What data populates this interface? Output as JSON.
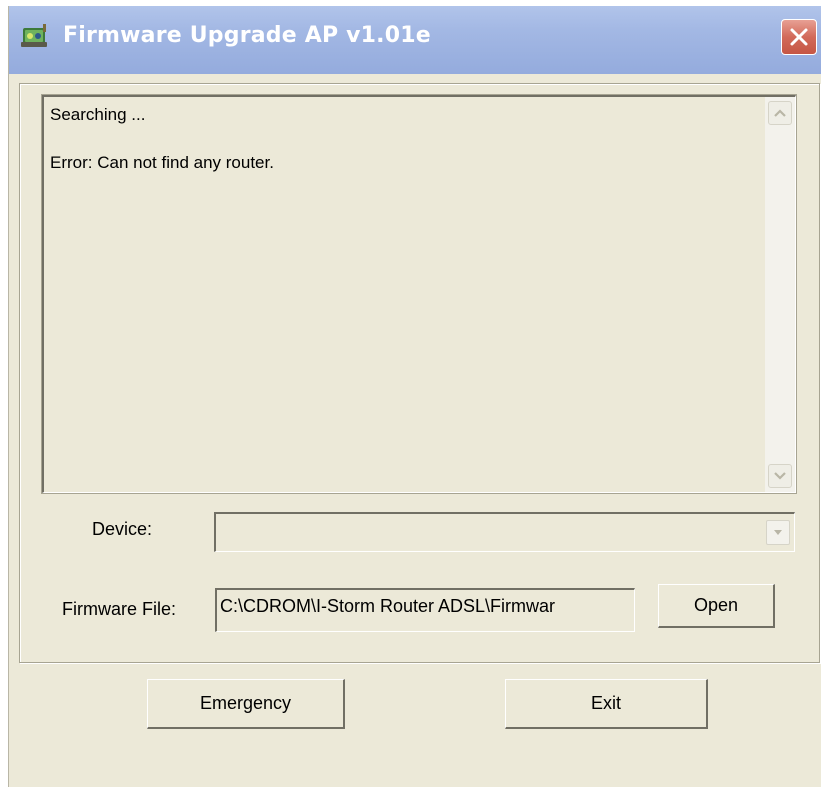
{
  "window": {
    "title": "Firmware Upgrade AP v1.01e",
    "icon": "router-network-icon",
    "close_icon": "close-icon"
  },
  "log": {
    "lines": [
      "Searching ...",
      "Error: Can not find any router."
    ]
  },
  "device": {
    "label": "Device:",
    "value": ""
  },
  "firmware": {
    "label": "Firmware File:",
    "value": "C:\\CDROM\\I-Storm Router ADSL\\Firmwar",
    "open_label": "Open"
  },
  "buttons": {
    "emergency": "Emergency",
    "exit": "Exit"
  },
  "colors": {
    "titlebar": "#a3b8e4",
    "window_bg": "#ece9d8",
    "close_button": "#d26a5a"
  }
}
